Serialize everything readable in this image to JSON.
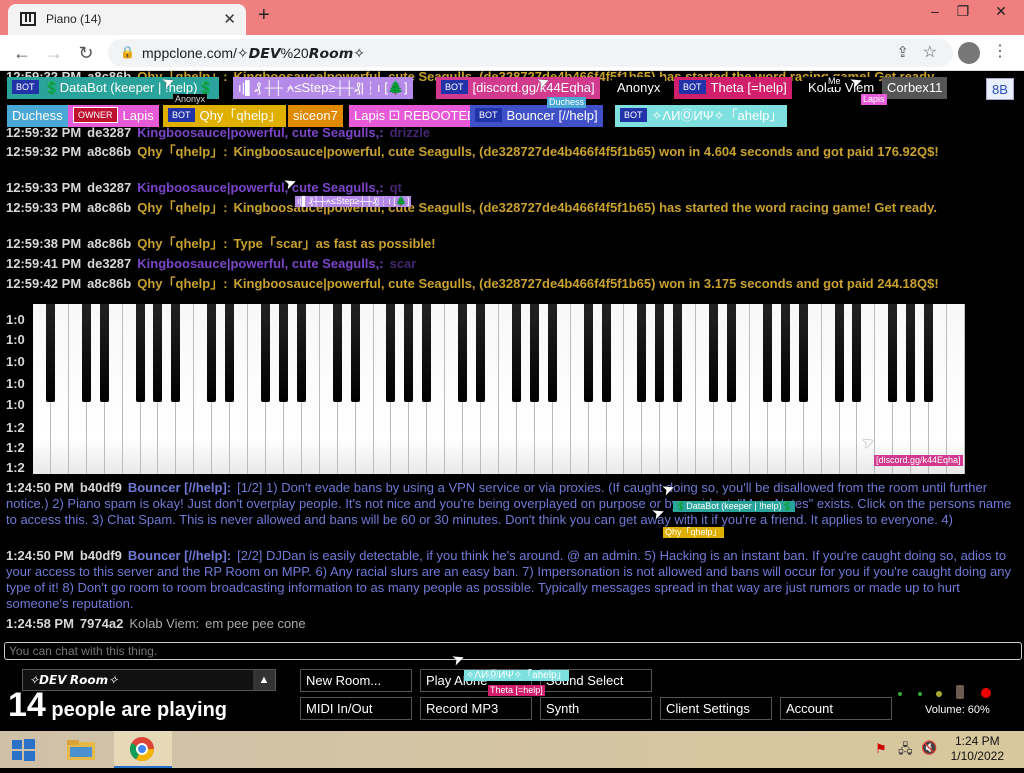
{
  "browser": {
    "tab_title": "Piano (14)",
    "url": "mppclone.com/✧𝘿𝙀𝙑%20𝙍𝙤𝙤𝙢✧",
    "win_min": "–",
    "win_max": "❐",
    "win_close": "✕",
    "tab_close": "✕",
    "new_tab": "+"
  },
  "users_row1": [
    {
      "bot": "BOT",
      "name": "💲DataBot (keeper | !help)💲",
      "bg": "#2aa49a"
    },
    {
      "name": "ı|▌₰ ┼┼ ⍲≤Step≥┼┼₰|┆ı [🌲]",
      "bg": "#b68ae8"
    },
    {
      "bot": "BOT",
      "name": "[discord.gg/k44Eqha]",
      "bg": "#d23a8e"
    },
    {
      "name": "Anonyx",
      "bg": "#000"
    },
    {
      "bot": "BOT",
      "name": "Theta [=help]",
      "bg": "#d21f6c"
    },
    {
      "name": "Kolab Viem",
      "bg": "#000"
    },
    {
      "name": "Corbex11",
      "bg": "#555"
    }
  ],
  "users_row2": [
    {
      "name": "Duchess",
      "bg": "#4aa8d6"
    },
    {
      "owner": "OWNER",
      "name": "Lapis",
      "bg": "#e65ad7"
    },
    {
      "bot": "BOT",
      "name": "Qhy「qhelp」",
      "bg": "#e0b000"
    },
    {
      "name": "siceon7",
      "bg": "#e08a00"
    },
    {
      "name": "Lapis ⚀ REBOOTED",
      "bg": "#e65ad7"
    },
    {
      "bot": "BOT",
      "name": "Bouncer [//help]",
      "bg": "#4050c8"
    },
    {
      "bot": "BOT",
      "name": "✧ΛИⓄИΨ✧「ahelp」",
      "bg": "#7fe0e0"
    }
  ],
  "user_8b": "8B",
  "cursor_tags": {
    "anonyx": "Anonyx",
    "duchess": "Duchess",
    "me": "Me",
    "lapis": "Lapis",
    "step": "ı|▌₰┼┼⍲≤Step≥┼┼₰|┆ı [🌲]",
    "discord": "[discord.gg/k44Eqha]",
    "databot": "💲DataBot (keeper | !help)💲",
    "qhy": "Qhy「qhelp」",
    "anonyw": "✧ΛИⓄИΨ✧「ahelp」",
    "theta": "Theta [=help]"
  },
  "messages_top": [
    {
      "ts": "12:59:32 PM",
      "id": "a8c86b",
      "name": "Qhy「qhelp」:",
      "text": "Kingboosauce|powerful, cute Seagulls, (de328727de4b466f4f5f1b65) has started the word racing game! Get ready.",
      "cls": "gold"
    },
    {
      "ts": "12:59:32 PM",
      "id": "de3287",
      "name": "Kingboosauce|powerful, cute Seagulls,:",
      "text": "drizzle",
      "cls": "violet"
    },
    {
      "ts": "12:59:32 PM",
      "id": "a8c86b",
      "name": "Qhy「qhelp」:",
      "text": "Kingboosauce|powerful, cute Seagulls, (de328727de4b466f4f5f1b65) won in 4.604 seconds and got paid 176.92Q$!",
      "cls": "gold"
    },
    {
      "ts": "12:59:33 PM",
      "id": "de3287",
      "name": "Kingboosauce|powerful, cute Seagulls,:",
      "text": "qt",
      "cls": "violet"
    },
    {
      "ts": "12:59:33 PM",
      "id": "a8c86b",
      "name": "Qhy「qhelp」:",
      "text": "Kingboosauce|powerful, cute Seagulls, (de328727de4b466f4f5f1b65) has started the word racing game! Get ready.",
      "cls": "gold"
    },
    {
      "ts": "12:59:38 PM",
      "id": "a8c86b",
      "name": "Qhy「qhelp」:",
      "text": "Type「scar」as fast as possible!",
      "cls": "gold"
    },
    {
      "ts": "12:59:41 PM",
      "id": "de3287",
      "name": "Kingboosauce|powerful, cute Seagulls,:",
      "text": "scar",
      "cls": "violet"
    },
    {
      "ts": "12:59:42 PM",
      "id": "a8c86b",
      "name": "Qhy「qhelp」:",
      "text": "Kingboosauce|powerful, cute Seagulls, (de328727de4b466f4f5f1b65) won in 3.175 seconds and got paid 244.18Q$!",
      "cls": "gold"
    }
  ],
  "hidden_ts": [
    "1:0",
    "1:0",
    "1:0",
    "1:0",
    "1:0",
    "1:2",
    "1:2",
    "1:2"
  ],
  "messages_bottom": [
    {
      "ts": "1:24:50 PM",
      "id": "b40df9",
      "name": "Bouncer [//help]:",
      "text": "[1/2] 1) Don't evade bans by using a VPN service or via proxies. (If caught doing so, you'll be disallowed from the room until further notice.) 2) Piano spam is okay! Just don't overplay people. It's not nice and you're being overplayed on purpose or by accident, \"Mute Notes\" exists. Click on the persons name to access this. 3) Chat Spam. This is never allowed and bans will be 60 or 30 minutes. Don't think you can get away with it if you're a friend. It applies to everyone. 4)",
      "cls": "blue"
    },
    {
      "ts": "1:24:50 PM",
      "id": "b40df9",
      "name": "Bouncer [//help]:",
      "text": "[2/2] DJDan is easily detectable, if you think he's around. @ an admin. 5) Hacking is an instant ban. If you're caught doing so, adios to your access to this server and the RP Room on MPP. 6) Any racial slurs are an easy ban. 7) Impersonation is not allowed and bans will occur for you if you're caught doing any type of it! 8) Don't go room to room broadcasting information to as many people as possible. Typically messages spread in that way are just rumors or made up to hurt someone's reputation.",
      "cls": "blue"
    },
    {
      "ts": "1:24:58 PM",
      "id": "7974a2",
      "name": "Kolab Viem:",
      "text": "em pee pee cone",
      "cls": "grey"
    }
  ],
  "chat_placeholder": "You can chat with this thing.",
  "room_name": "✧𝘿𝙀𝙑 𝙍𝙤𝙤𝙢✧",
  "room_arrow": "▲",
  "people_count": "14",
  "people_label": "people are playing",
  "controls": {
    "new_room": "New Room...",
    "play_alone": "Play Alone",
    "sound_select": "Sound Select",
    "midi": "MIDI In/Out",
    "record": "Record MP3",
    "synth": "Synth",
    "client_settings": "Client Settings",
    "account": "Account"
  },
  "volume": "Volume: 60%",
  "clock": {
    "time": "1:24 PM",
    "date": "1/10/2022"
  }
}
